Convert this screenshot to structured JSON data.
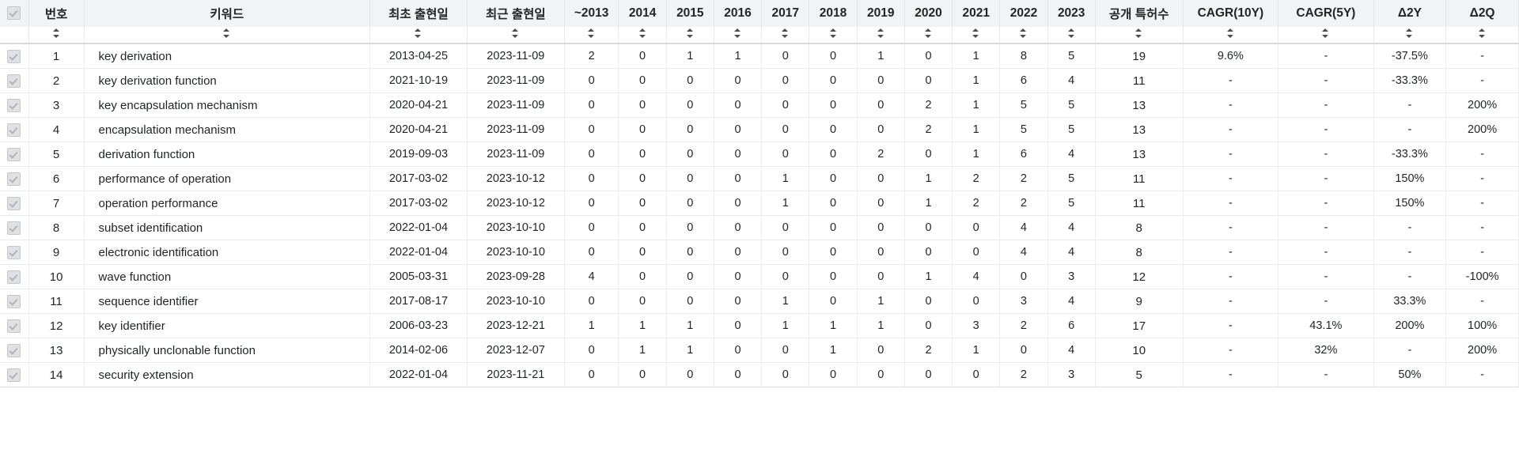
{
  "table": {
    "headers": {
      "select_all": "select-all-checkbox",
      "no": "번호",
      "keyword": "키워드",
      "first_date": "최초 출현일",
      "last_date": "최근 출현일",
      "y2013": "~2013",
      "y2014": "2014",
      "y2015": "2015",
      "y2016": "2016",
      "y2017": "2017",
      "y2018": "2018",
      "y2019": "2019",
      "y2020": "2020",
      "y2021": "2021",
      "y2022": "2022",
      "y2023": "2023",
      "total": "공개 특허수",
      "cagr10": "CAGR(10Y)",
      "cagr5": "CAGR(5Y)",
      "d2y": "Δ2Y",
      "d2q": "Δ2Q"
    },
    "sort_icon": "sort-updown-icon",
    "checkbox_icon": "checkbox-checked-icon",
    "rows": [
      {
        "no": "1",
        "keyword": "key derivation",
        "first_date": "2013-04-25",
        "last_date": "2023-11-09",
        "years": [
          "2",
          "0",
          "1",
          "1",
          "0",
          "0",
          "1",
          "0",
          "1",
          "8",
          "5"
        ],
        "total": "19",
        "cagr10": "9.6%",
        "cagr5": "-",
        "d2y": "-37.5%",
        "d2q": "-"
      },
      {
        "no": "2",
        "keyword": "key derivation function",
        "first_date": "2021-10-19",
        "last_date": "2023-11-09",
        "years": [
          "0",
          "0",
          "0",
          "0",
          "0",
          "0",
          "0",
          "0",
          "1",
          "6",
          "4"
        ],
        "total": "11",
        "cagr10": "-",
        "cagr5": "-",
        "d2y": "-33.3%",
        "d2q": "-"
      },
      {
        "no": "3",
        "keyword": "key encapsulation mechanism",
        "first_date": "2020-04-21",
        "last_date": "2023-11-09",
        "years": [
          "0",
          "0",
          "0",
          "0",
          "0",
          "0",
          "0",
          "2",
          "1",
          "5",
          "5"
        ],
        "total": "13",
        "cagr10": "-",
        "cagr5": "-",
        "d2y": "-",
        "d2q": "200%"
      },
      {
        "no": "4",
        "keyword": "encapsulation mechanism",
        "first_date": "2020-04-21",
        "last_date": "2023-11-09",
        "years": [
          "0",
          "0",
          "0",
          "0",
          "0",
          "0",
          "0",
          "2",
          "1",
          "5",
          "5"
        ],
        "total": "13",
        "cagr10": "-",
        "cagr5": "-",
        "d2y": "-",
        "d2q": "200%"
      },
      {
        "no": "5",
        "keyword": "derivation function",
        "first_date": "2019-09-03",
        "last_date": "2023-11-09",
        "years": [
          "0",
          "0",
          "0",
          "0",
          "0",
          "0",
          "2",
          "0",
          "1",
          "6",
          "4"
        ],
        "total": "13",
        "cagr10": "-",
        "cagr5": "-",
        "d2y": "-33.3%",
        "d2q": "-"
      },
      {
        "no": "6",
        "keyword": "performance of operation",
        "first_date": "2017-03-02",
        "last_date": "2023-10-12",
        "years": [
          "0",
          "0",
          "0",
          "0",
          "1",
          "0",
          "0",
          "1",
          "2",
          "2",
          "5"
        ],
        "total": "11",
        "cagr10": "-",
        "cagr5": "-",
        "d2y": "150%",
        "d2q": "-"
      },
      {
        "no": "7",
        "keyword": "operation performance",
        "first_date": "2017-03-02",
        "last_date": "2023-10-12",
        "years": [
          "0",
          "0",
          "0",
          "0",
          "1",
          "0",
          "0",
          "1",
          "2",
          "2",
          "5"
        ],
        "total": "11",
        "cagr10": "-",
        "cagr5": "-",
        "d2y": "150%",
        "d2q": "-"
      },
      {
        "no": "8",
        "keyword": "subset identification",
        "first_date": "2022-01-04",
        "last_date": "2023-10-10",
        "years": [
          "0",
          "0",
          "0",
          "0",
          "0",
          "0",
          "0",
          "0",
          "0",
          "4",
          "4"
        ],
        "total": "8",
        "cagr10": "-",
        "cagr5": "-",
        "d2y": "-",
        "d2q": "-"
      },
      {
        "no": "9",
        "keyword": "electronic identification",
        "first_date": "2022-01-04",
        "last_date": "2023-10-10",
        "years": [
          "0",
          "0",
          "0",
          "0",
          "0",
          "0",
          "0",
          "0",
          "0",
          "4",
          "4"
        ],
        "total": "8",
        "cagr10": "-",
        "cagr5": "-",
        "d2y": "-",
        "d2q": "-"
      },
      {
        "no": "10",
        "keyword": "wave function",
        "first_date": "2005-03-31",
        "last_date": "2023-09-28",
        "years": [
          "4",
          "0",
          "0",
          "0",
          "0",
          "0",
          "0",
          "1",
          "4",
          "0",
          "3"
        ],
        "total": "12",
        "cagr10": "-",
        "cagr5": "-",
        "d2y": "-",
        "d2q": "-100%"
      },
      {
        "no": "11",
        "keyword": "sequence identifier",
        "first_date": "2017-08-17",
        "last_date": "2023-10-10",
        "years": [
          "0",
          "0",
          "0",
          "0",
          "1",
          "0",
          "1",
          "0",
          "0",
          "3",
          "4"
        ],
        "total": "9",
        "cagr10": "-",
        "cagr5": "-",
        "d2y": "33.3%",
        "d2q": "-"
      },
      {
        "no": "12",
        "keyword": "key identifier",
        "first_date": "2006-03-23",
        "last_date": "2023-12-21",
        "years": [
          "1",
          "1",
          "1",
          "0",
          "1",
          "1",
          "1",
          "0",
          "3",
          "2",
          "6"
        ],
        "total": "17",
        "cagr10": "-",
        "cagr5": "43.1%",
        "d2y": "200%",
        "d2q": "100%"
      },
      {
        "no": "13",
        "keyword": "physically unclonable function",
        "first_date": "2014-02-06",
        "last_date": "2023-12-07",
        "years": [
          "0",
          "1",
          "1",
          "0",
          "0",
          "1",
          "0",
          "2",
          "1",
          "0",
          "4"
        ],
        "total": "10",
        "cagr10": "-",
        "cagr5": "32%",
        "d2y": "-",
        "d2q": "200%"
      },
      {
        "no": "14",
        "keyword": "security extension",
        "first_date": "2022-01-04",
        "last_date": "2023-11-21",
        "years": [
          "0",
          "0",
          "0",
          "0",
          "0",
          "0",
          "0",
          "0",
          "0",
          "2",
          "3"
        ],
        "total": "5",
        "cagr10": "-",
        "cagr5": "-",
        "d2y": "50%",
        "d2q": "-"
      }
    ]
  },
  "colors": {
    "header_bg": "#f2f3f5",
    "row_border": "#e8eaec",
    "text": "#1f2326",
    "checkbox_bg": "#dfe1e4"
  }
}
